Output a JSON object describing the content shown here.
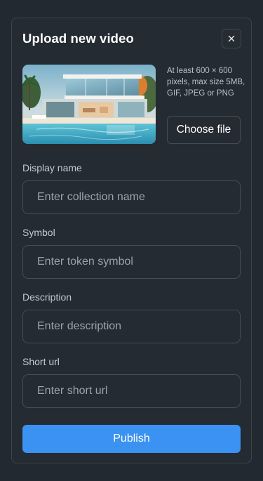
{
  "dialog": {
    "title": "Upload new video",
    "close_icon": "close-icon"
  },
  "upload": {
    "thumbnail_subject": "modern house with pool",
    "hint": "At least 600 × 600 pixels, max size 5MB, GIF, JPEG or PNG",
    "choose_label": "Choose file"
  },
  "fields": {
    "display_name": {
      "label": "Display name",
      "placeholder": "Enter collection name",
      "value": ""
    },
    "symbol": {
      "label": "Symbol",
      "placeholder": "Enter token symbol",
      "value": ""
    },
    "description": {
      "label": "Description",
      "placeholder": "Enter description",
      "value": ""
    },
    "short_url": {
      "label": "Short url",
      "placeholder": "Enter short url",
      "value": ""
    }
  },
  "actions": {
    "publish_label": "Publish"
  },
  "colors": {
    "background": "#222931",
    "panel": "#242b33",
    "border": "#454d57",
    "accent": "#3b92f3"
  }
}
